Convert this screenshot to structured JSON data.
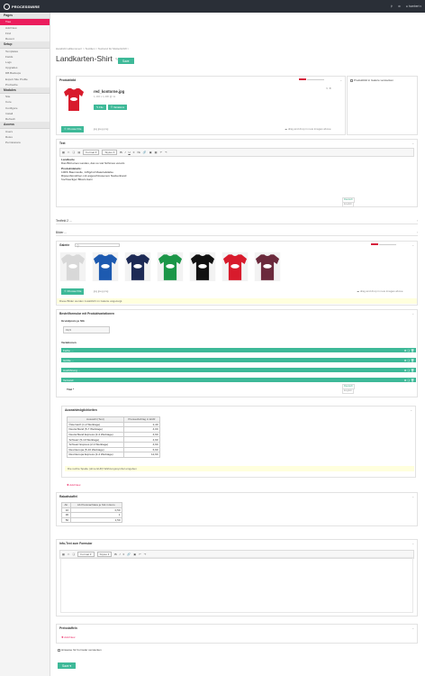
{
  "app": {
    "name": "PROCESSWIRE",
    "user": "humbert"
  },
  "sidebar": {
    "pages_head": "Pages",
    "pages_items": [
      "Tree",
      "Add New",
      "Find",
      "Recent"
    ],
    "setup_head": "Setup",
    "setup_items": [
      "Templates",
      "Fields",
      "Logs",
      "Upgrades",
      "DB Backups",
      "Export Site Profile",
      "ProCache"
    ],
    "modules_head": "Modules",
    "modules_items": [
      "Site",
      "Core",
      "Configure",
      "Install",
      "Refresh"
    ],
    "access_head": "Access",
    "access_items": [
      "Users",
      "Roles",
      "Permissions"
    ]
  },
  "breadcrumb": "Handicht willkommen! > Textilien > Textlund für Muttertichtfl >",
  "page_title": "Landkarten-Shirt",
  "buttons": {
    "save": "Save",
    "choose_file": "Choose File",
    "add_new": "Add New"
  },
  "produktbild": {
    "label": "Produktbild",
    "filename": "red_kontorne.jpg",
    "filemeta": "1,102 x 1,400 @ 1x",
    "file_label": "File",
    "variations_label": "Variations",
    "filetypes": "jpg jpeg png",
    "dropzone": "drag and drop in new images above",
    "hide_label": "Produktbild in Galerie verstecken"
  },
  "text_field": {
    "label": "Text",
    "toolbar": {
      "format": "Format",
      "styles": "Styles"
    },
    "content": {
      "heading1": "Landkarte",
      "line1": "Das Bild eines Landes, das so viel Schönes vereint.",
      "heading2": "Produktdetails:",
      "line2": "100% Baumwolle, 145g/m2 Materialstärke",
      "line3": "Rippenbündchen mit angeschlossenem Nackenband",
      "line4": "hochwertiger Bikoni-Garn"
    },
    "lang_de": "Deutsch",
    "lang_en": "English"
  },
  "collapsed": {
    "textfeld2": "Textfeld 2 ...",
    "bilder": "Bilder ..."
  },
  "galerie": {
    "label": "Galerie",
    "shirt_colors": [
      "#d8d8d8",
      "#1d5ab0",
      "#1d2a55",
      "#1c9648",
      "#111111",
      "#d81b2c",
      "#6b2a3c"
    ],
    "filetypes": "jpg jpeg png",
    "dropzone": "drag and drop in new images above",
    "note": "Diese Bilder werden zusätzlich im Galerie angezeigt."
  },
  "bestell": {
    "label": "Bestellformular mit Produktvariationen",
    "stundenlohn_label": "Grundpreis je Stk",
    "stundenlohn_value": "19,9",
    "variationen_label": "Variationen",
    "variants": [
      "Farbe ...",
      "Größe ...",
      "Ausführung ...",
      "Versand"
    ],
    "titel_label": "Titel *"
  },
  "auswahl": {
    "label": "Auswahlmöglichkeiten",
    "col1": "Auswahl (Text)",
    "col2": "Preisaufschlag in EUR",
    "rows": [
      [
        "Österreich (1-2 Werktage)",
        "2,40"
      ],
      [
        "Deutschland (5-7 Werktage)",
        "4,00"
      ],
      [
        "Deutschland Express (2-4 Werktage)",
        "4,90"
      ],
      [
        "Schweiz (5-10 Werktage)",
        "4,90"
      ],
      [
        "Schweiz Express (2-4 Werktage)",
        "4,90"
      ],
      [
        "Rest Europa (5-10 Werktage)",
        "6,90"
      ],
      [
        "Rest Europa Express (2-4 Werktage)",
        "12,90"
      ]
    ],
    "note": "Die rechte Spalte (ohne EUR) Währungssymbol eingeben"
  },
  "rabatt": {
    "label": "Rabattstaffel",
    "col1": "Ab",
    "col2": "Ab Preisnachlass je Stk in Euro",
    "rows": [
      [
        "10",
        "0,50"
      ],
      [
        "30",
        "1"
      ],
      [
        "50",
        "1,50"
      ]
    ]
  },
  "infotext": {
    "label": "Info-Text zum Formular",
    "format": "Format",
    "styles": "Styles"
  },
  "preisstaffeln": {
    "label": "Preisstaffeln"
  },
  "hide_form": {
    "label": "Hinweise für Formular verstecken"
  }
}
